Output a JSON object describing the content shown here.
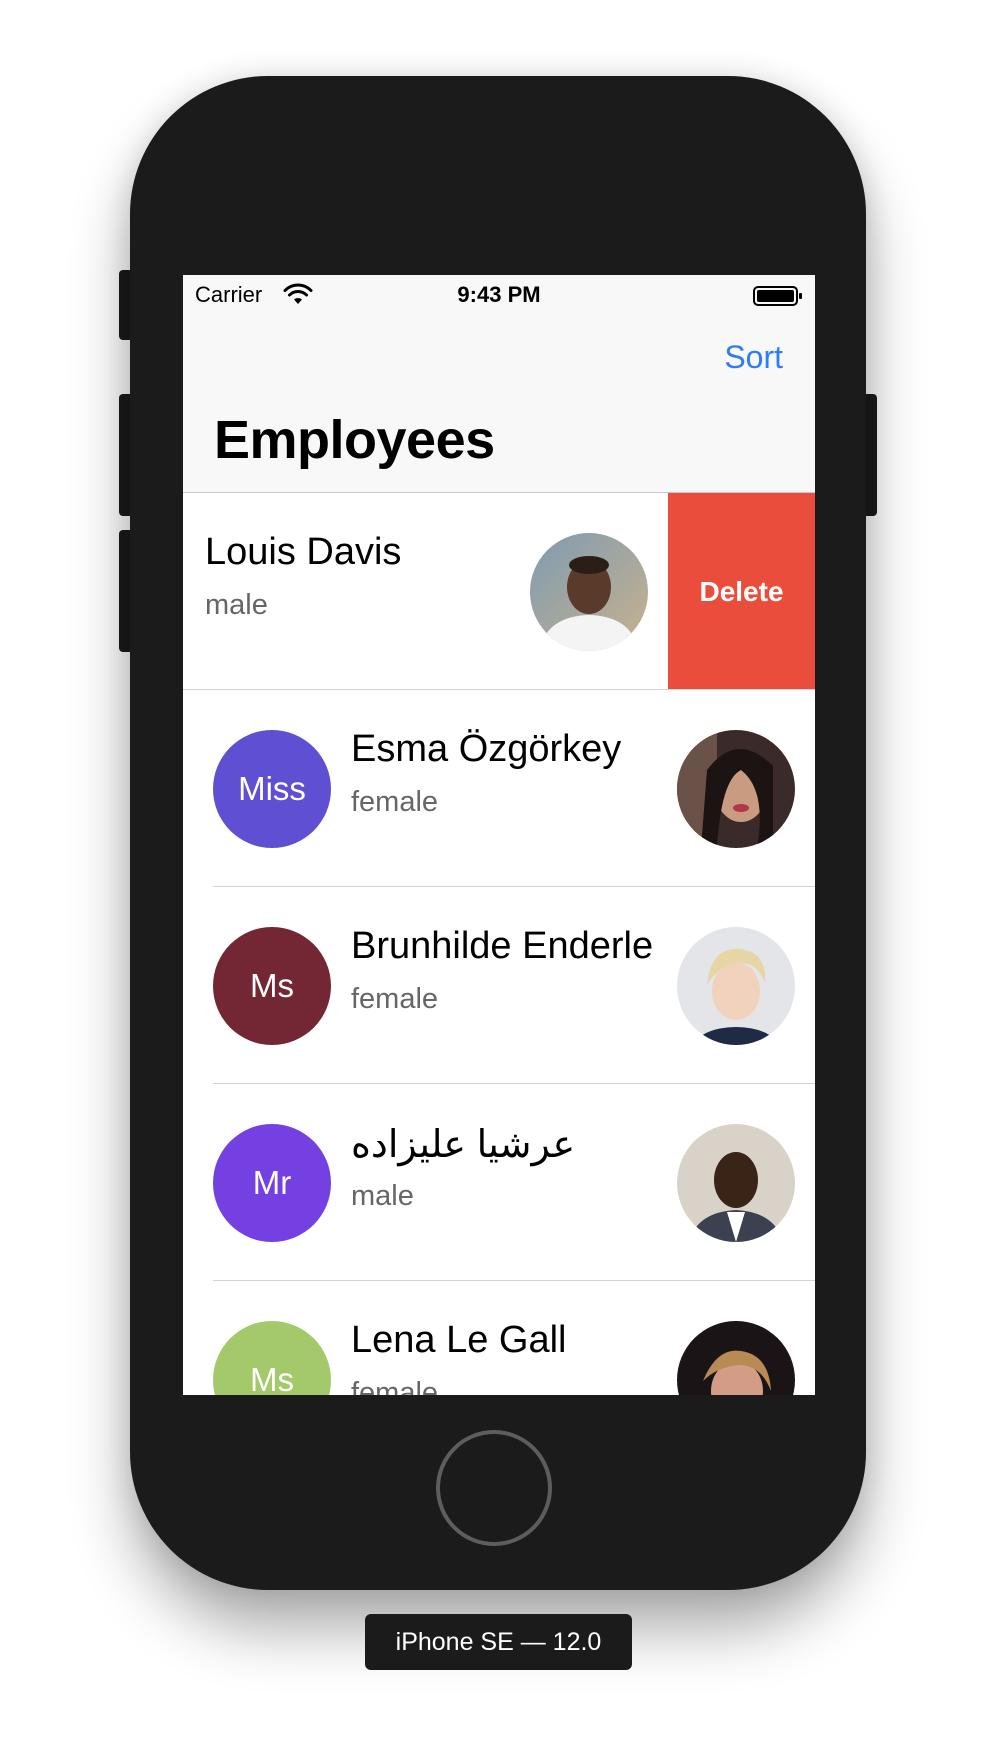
{
  "status_bar": {
    "carrier": "Carrier",
    "time": "9:43 PM"
  },
  "nav": {
    "sort_label": "Sort",
    "title": "Employees"
  },
  "swipe_action": {
    "delete_label": "Delete"
  },
  "employees": [
    {
      "title": "",
      "name": "Louis Davis",
      "gender": "male",
      "avatar_color": "#9bbd3a",
      "photo": "man-portrait-photo"
    },
    {
      "title": "Miss",
      "name": "Esma Özgörkey",
      "gender": "female",
      "avatar_color": "#5f4fd2",
      "photo": "woman-portrait-photo"
    },
    {
      "title": "Ms",
      "name": "Brunhilde Enderle",
      "gender": "female",
      "avatar_color": "#732634",
      "photo": "woman-portrait-photo"
    },
    {
      "title": "Mr",
      "name": "عرشيا عليزاده",
      "gender": "male",
      "avatar_color": "#7540e2",
      "photo": "man-portrait-photo"
    },
    {
      "title": "Ms",
      "name": "Lena Le Gall",
      "gender": "female",
      "avatar_color": "#a3c96a",
      "photo": "woman-portrait-photo"
    }
  ],
  "device_label": "iPhone SE — 12.0",
  "colors": {
    "tint": "#2f7cf6",
    "destructive": "#eb4d3d",
    "device_body": "#1b1b1b"
  }
}
